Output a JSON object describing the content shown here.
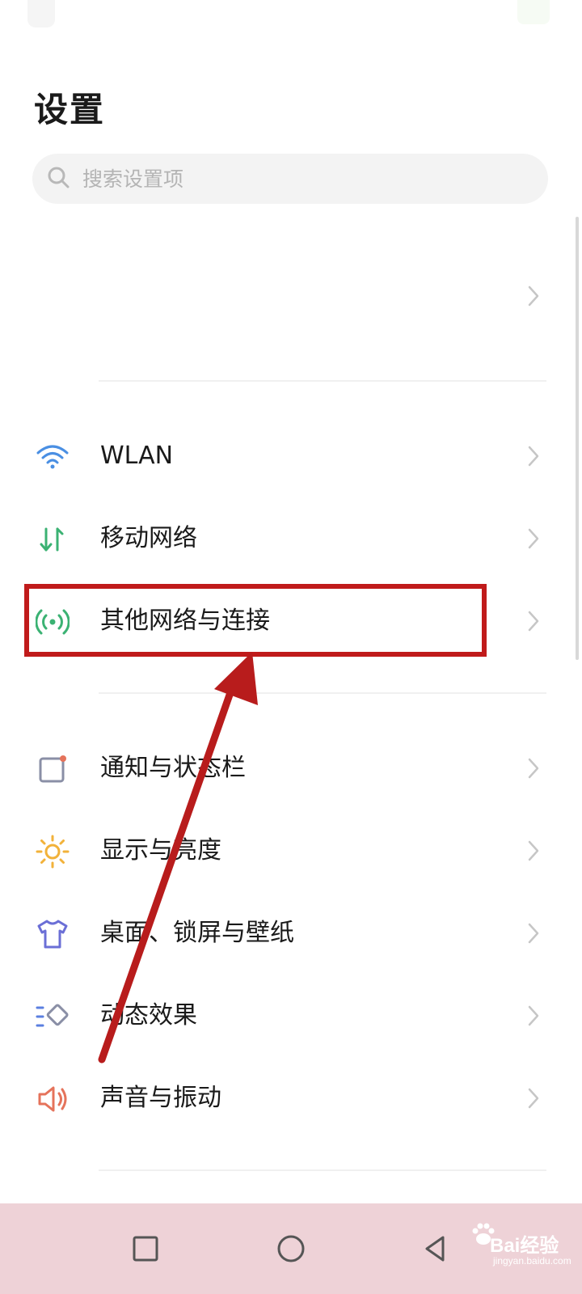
{
  "header": {
    "title": "设置"
  },
  "search": {
    "placeholder": "搜索设置项"
  },
  "settings": {
    "wlan": {
      "label": "WLAN",
      "icon": "wifi-icon",
      "color": "#4a8fe3"
    },
    "mobile": {
      "label": "移动网络",
      "icon": "mobile-data-icon",
      "color": "#3bb273"
    },
    "other": {
      "label": "其他网络与连接",
      "icon": "connection-icon",
      "color": "#3bb273"
    },
    "notify": {
      "label": "通知与状态栏",
      "icon": "notification-icon",
      "color": "#8a8fa6"
    },
    "display": {
      "label": "显示与亮度",
      "icon": "sun-icon",
      "color": "#f2b23a"
    },
    "desktop": {
      "label": "桌面、锁屏与壁纸",
      "icon": "tshirt-icon",
      "color": "#6b6fd6"
    },
    "effects": {
      "label": "动态效果",
      "icon": "motion-icon",
      "color": "#5b7fe0"
    },
    "sound": {
      "label": "声音与振动",
      "icon": "speaker-icon",
      "color": "#e5735b"
    }
  },
  "annotation": {
    "highlight_color": "#c01b1b"
  },
  "navbar": {
    "background": "#eed2d7"
  },
  "watermark": {
    "text": "Bai经验",
    "sub": "jingyan.baidu.com"
  }
}
